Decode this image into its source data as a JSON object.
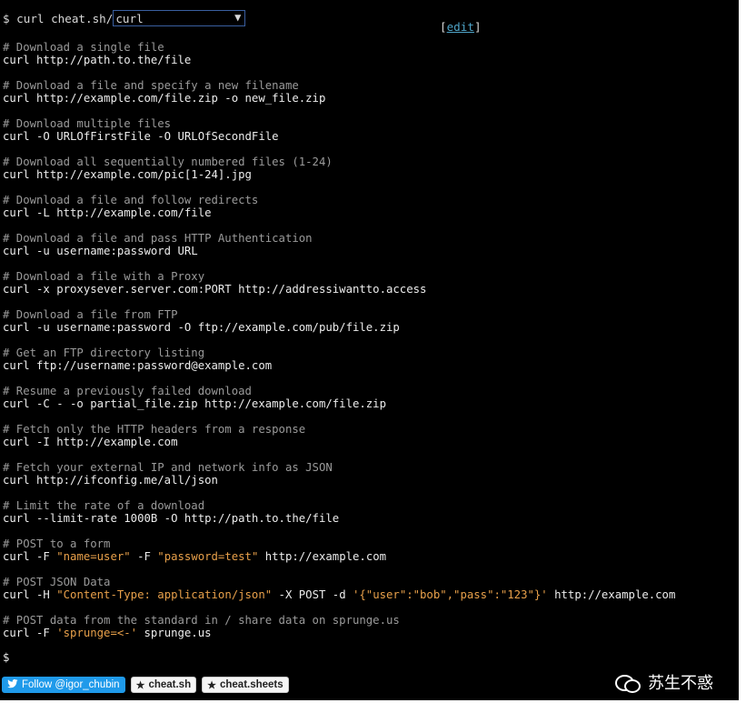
{
  "prompt": "$ curl cheat.sh/",
  "topic_selected": "curl",
  "edit": {
    "open": "[",
    "label": "edit",
    "close": "]"
  },
  "entries": [
    {
      "comment": "# Download a single file",
      "parts": [
        {
          "t": "curl http://path.to.the/file",
          "s": false
        }
      ]
    },
    {
      "comment": "# Download a file and specify a new filename",
      "parts": [
        {
          "t": "curl http://example.com/file.zip -o new_file.zip",
          "s": false
        }
      ]
    },
    {
      "comment": "# Download multiple files",
      "parts": [
        {
          "t": "curl -O URLOfFirstFile -O URLOfSecondFile",
          "s": false
        }
      ]
    },
    {
      "comment": "# Download all sequentially numbered files (1-24)",
      "parts": [
        {
          "t": "curl http://example.com/pic[1-24].jpg",
          "s": false
        }
      ]
    },
    {
      "comment": "# Download a file and follow redirects",
      "parts": [
        {
          "t": "curl -L http://example.com/file",
          "s": false
        }
      ]
    },
    {
      "comment": "# Download a file and pass HTTP Authentication",
      "parts": [
        {
          "t": "curl -u username:password URL",
          "s": false
        }
      ]
    },
    {
      "comment": "# Download a file with a Proxy",
      "parts": [
        {
          "t": "curl -x proxysever.server.com:PORT http://addressiwantto.access",
          "s": false
        }
      ]
    },
    {
      "comment": "# Download a file from FTP",
      "parts": [
        {
          "t": "curl -u username:password -O ftp://example.com/pub/file.zip",
          "s": false
        }
      ]
    },
    {
      "comment": "# Get an FTP directory listing",
      "parts": [
        {
          "t": "curl ftp://username:password@example.com",
          "s": false
        }
      ]
    },
    {
      "comment": "# Resume a previously failed download",
      "parts": [
        {
          "t": "curl -C - -o partial_file.zip http://example.com/file.zip",
          "s": false
        }
      ]
    },
    {
      "comment": "# Fetch only the HTTP headers from a response",
      "parts": [
        {
          "t": "curl -I http://example.com",
          "s": false
        }
      ]
    },
    {
      "comment": "# Fetch your external IP and network info as JSON",
      "parts": [
        {
          "t": "curl http://ifconfig.me/all/json",
          "s": false
        }
      ]
    },
    {
      "comment": "# Limit the rate of a download",
      "parts": [
        {
          "t": "curl --limit-rate 1000B -O http://path.to.the/file",
          "s": false
        }
      ]
    },
    {
      "comment": "# POST to a form",
      "parts": [
        {
          "t": "curl -F ",
          "s": false
        },
        {
          "t": "\"name=user\"",
          "s": true
        },
        {
          "t": " -F ",
          "s": false
        },
        {
          "t": "\"password=test\"",
          "s": true
        },
        {
          "t": " http://example.com",
          "s": false
        }
      ]
    },
    {
      "comment": "# POST JSON Data",
      "parts": [
        {
          "t": "curl -H ",
          "s": false
        },
        {
          "t": "\"Content-Type: application/json\"",
          "s": true
        },
        {
          "t": " -X POST -d ",
          "s": false
        },
        {
          "t": "'{\"user\":\"bob\",\"pass\":\"123\"}'",
          "s": true
        },
        {
          "t": " http://example.com",
          "s": false
        }
      ]
    },
    {
      "comment": "# POST data from the standard in / share data on sprunge.us",
      "parts": [
        {
          "t": "curl -F ",
          "s": false
        },
        {
          "t": "'sprunge=<-'",
          "s": true
        },
        {
          "t": " sprunge.us",
          "s": false
        }
      ]
    }
  ],
  "final_prompt": "$",
  "buttons": {
    "twitter": "Follow @igor_chubin",
    "cheat_sh": "cheat.sh",
    "cheat_sheets": "cheat.sheets"
  },
  "watermark": "苏生不惑",
  "icons": {
    "twitter": "bird-icon",
    "star": "star-icon",
    "wechat": "wechat-icon"
  },
  "colors": {
    "background": "#000000",
    "comment": "#9a9a9a",
    "string": "#e8a04a",
    "link": "#4fa4c8",
    "twitter": "#1f9aea"
  }
}
